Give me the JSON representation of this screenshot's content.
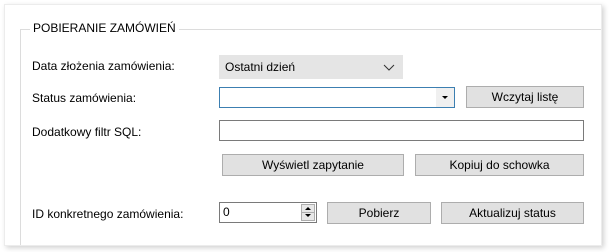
{
  "group": {
    "title": "POBIERANIE ZAMÓWIEŃ"
  },
  "fields": {
    "order_date": {
      "label": "Data złożenia zamówienia:",
      "value": "Ostatni dzień",
      "icon": "chevron-down-icon"
    },
    "order_status": {
      "label": "Status zamówienia:",
      "value": "",
      "icon": "dropdown-arrow-icon"
    },
    "sql_filter": {
      "label": "Dodatkowy filtr SQL:",
      "value": ""
    },
    "order_id": {
      "label": "ID konkretnego zamówienia:",
      "value": "0",
      "icon": "spin-buttons-icon"
    }
  },
  "buttons": {
    "load_list": "Wczytaj listę",
    "show_query": "Wyświetl zapytanie",
    "copy_clipboard": "Kopiuj do schowka",
    "fetch": "Pobierz",
    "update_status": "Aktualizuj status"
  }
}
